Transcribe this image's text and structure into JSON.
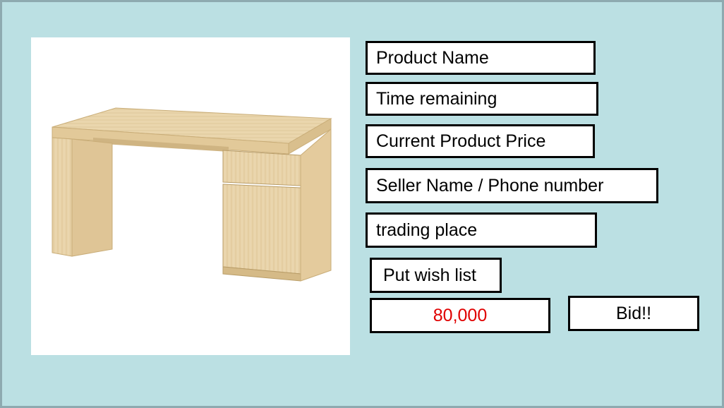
{
  "product": {
    "image_alt": "Wooden desk with drawer and cabinet"
  },
  "fields": {
    "product_name": "Product Name",
    "time_remaining": "Time remaining",
    "current_price": "Current Product Price",
    "seller": "Seller Name / Phone number",
    "trading_place": "trading place"
  },
  "actions": {
    "wish_list_label": "Put wish list",
    "bid_amount_value": "80,000",
    "bid_amount_color": "#e00000",
    "bid_label": "Bid!!"
  },
  "colors": {
    "background": "#bbe0e3",
    "frame_border": "#8eaab0",
    "desk_wood": "#e8d2a8"
  }
}
